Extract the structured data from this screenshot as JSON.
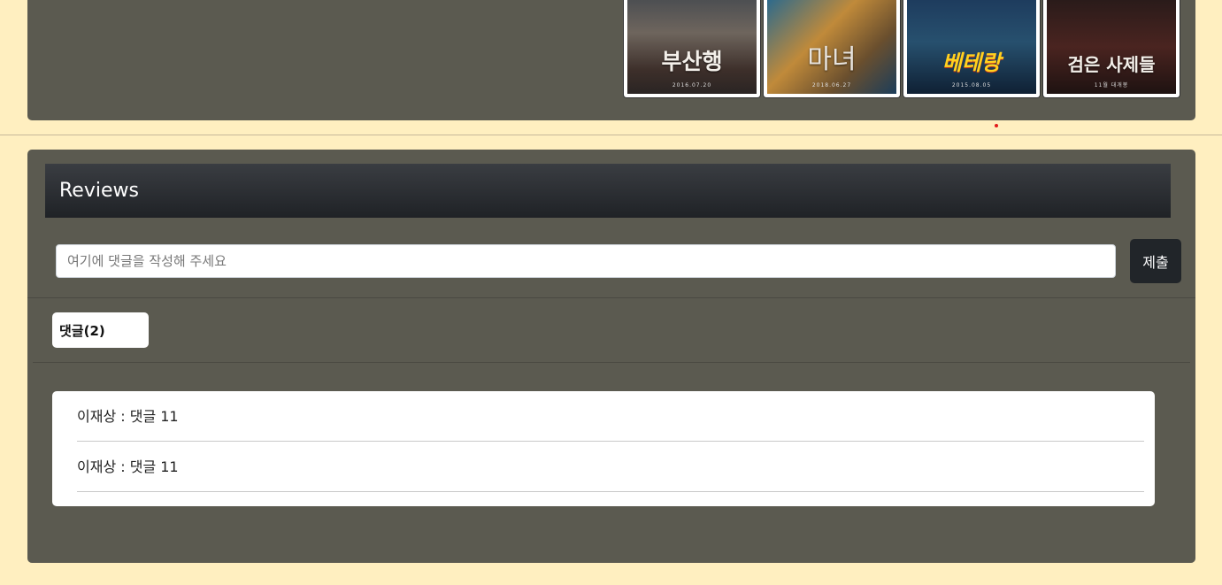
{
  "posters": [
    {
      "title": "부산행",
      "sub": "2016.07.20"
    },
    {
      "title": "마녀",
      "sub": "2018.06.27"
    },
    {
      "title": "베테랑",
      "sub": "2015.08.05"
    },
    {
      "title": "검은 사제들",
      "sub": "11월 대개봉"
    }
  ],
  "reviews": {
    "title": "Reviews",
    "input_placeholder": "여기에 댓글을 작성해 주세요",
    "input_value": "",
    "submit_label": "제출",
    "count_label": "댓글(2)",
    "comments": [
      {
        "text": "이재상 : 댓글 11"
      },
      {
        "text": "이재상 : 댓글 11"
      }
    ]
  },
  "colors": {
    "page_bg": "#ffefc0",
    "panel_bg": "#5b5a50",
    "header_dark": "#1f2226",
    "button_dark": "#212529",
    "accent_dot": "#e21b1b"
  }
}
